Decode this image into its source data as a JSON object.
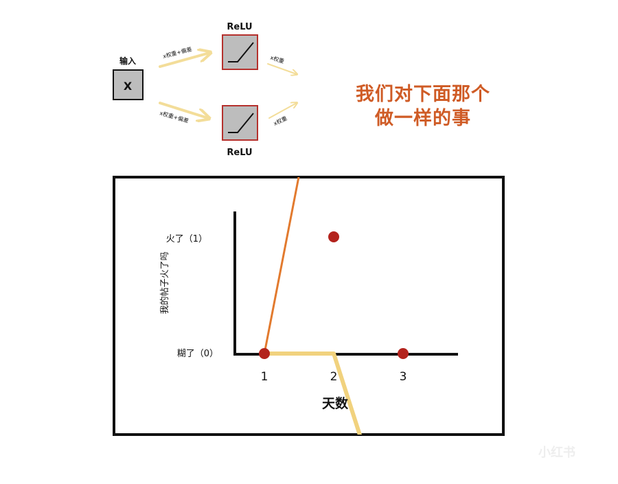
{
  "network": {
    "input_label": "输入",
    "input_node": "X",
    "relu_top_label": "ReLU",
    "relu_bottom_label": "ReLU",
    "edge_top_in": "x权重+偏差",
    "edge_bottom_in": "x权重+偏差",
    "edge_top_out": "x权重",
    "edge_bottom_out": "x权重"
  },
  "note": {
    "line1": "我们对下面那个",
    "line2": "做一样的事"
  },
  "plot": {
    "y_axis_label": "我的帖子火了吗",
    "y_ticks": [
      "火了（1）",
      "糊了（0）"
    ],
    "x_ticks": [
      "1",
      "2",
      "3"
    ],
    "x_axis_label": "天数"
  },
  "watermark": "小红书",
  "chart_data": {
    "type": "scatter",
    "xlabel": "天数",
    "ylabel": "我的帖子火了吗",
    "x_ticks": [
      "1",
      "2",
      "3"
    ],
    "y_ticks": [
      "糊了（0）",
      "火了（1）"
    ],
    "points": [
      {
        "x": 1,
        "y": 0
      },
      {
        "x": 2,
        "y": 1
      },
      {
        "x": 3,
        "y": 0
      }
    ],
    "lines": [
      {
        "color": "#e27a2e",
        "points": [
          [
            1,
            0
          ],
          [
            1.72,
            2.2
          ]
        ]
      },
      {
        "color": "#f1d27e",
        "points": [
          [
            1,
            0
          ],
          [
            2,
            0
          ],
          [
            2.55,
            -1.02
          ]
        ]
      }
    ],
    "colors": {
      "points": "#b3231d",
      "orange_line": "#e27a2e",
      "yellow_line": "#f1d27e",
      "note": "#cf5b25",
      "relu_box_border": "#b5302c",
      "node_fill": "#bdbdbd"
    }
  }
}
